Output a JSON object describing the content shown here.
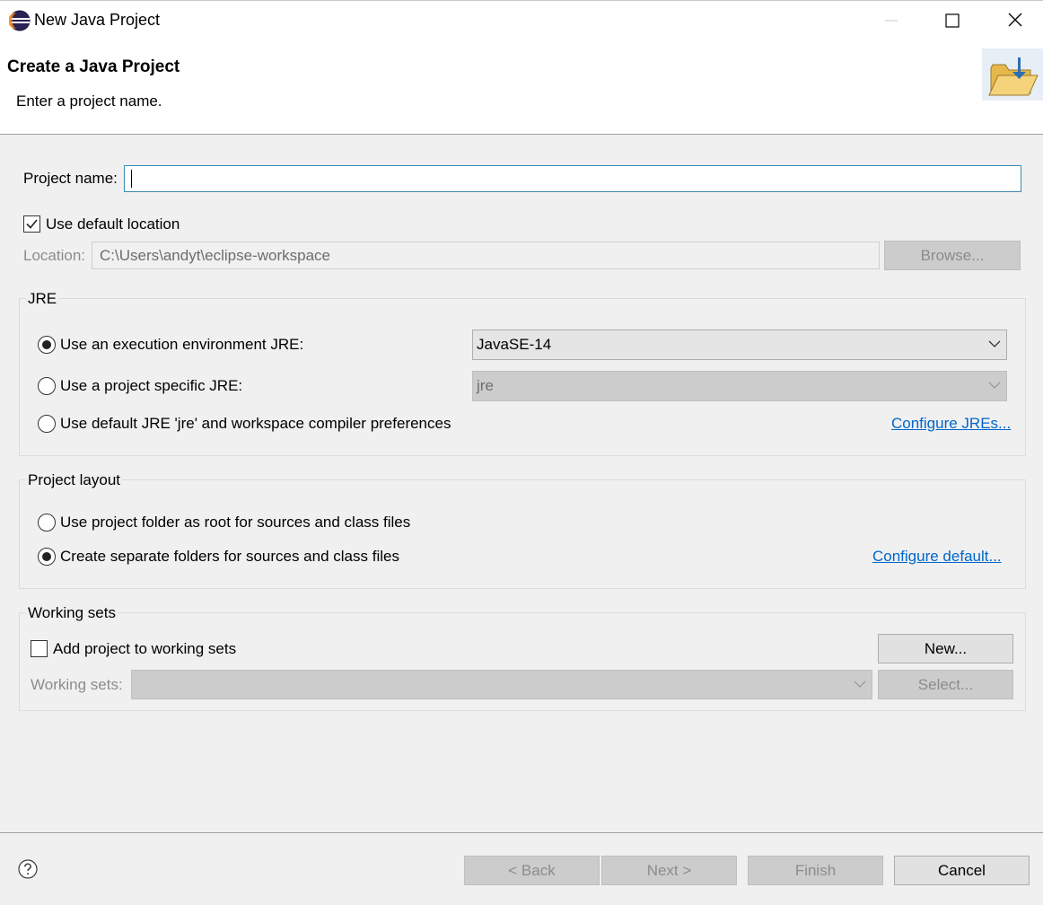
{
  "window": {
    "title": "New Java Project"
  },
  "header": {
    "title": "Create a Java Project",
    "message": "Enter a project name."
  },
  "project_name": {
    "label": "Project name:",
    "value": ""
  },
  "location": {
    "use_default_label": "Use default location",
    "use_default_checked": true,
    "label": "Location:",
    "value": "C:\\Users\\andyt\\eclipse-workspace",
    "browse_label": "Browse..."
  },
  "jre": {
    "group_title": "JRE",
    "options": [
      {
        "label": "Use an execution environment JRE:",
        "selected": true
      },
      {
        "label": "Use a project specific JRE:",
        "selected": false
      },
      {
        "label": "Use default JRE 'jre' and workspace compiler preferences",
        "selected": false
      }
    ],
    "env_combo_value": "JavaSE-14",
    "specific_combo_value": "jre",
    "configure_link": "Configure JREs..."
  },
  "layout": {
    "group_title": "Project layout",
    "options": [
      {
        "label": "Use project folder as root for sources and class files",
        "selected": false
      },
      {
        "label": "Create separate folders for sources and class files",
        "selected": true
      }
    ],
    "configure_link": "Configure default..."
  },
  "working_sets": {
    "group_title": "Working sets",
    "add_label": "Add project to working sets",
    "add_checked": false,
    "new_label": "New...",
    "sets_label": "Working sets:",
    "sets_value": "",
    "select_label": "Select..."
  },
  "footer": {
    "back_label": "< Back",
    "next_label": "Next >",
    "finish_label": "Finish",
    "cancel_label": "Cancel"
  },
  "icons": [
    "eclipse-icon",
    "minimize-icon",
    "maximize-icon",
    "close-icon",
    "folder-wizard-icon",
    "help-icon",
    "chevron-down-icon",
    "checkmark-icon"
  ]
}
